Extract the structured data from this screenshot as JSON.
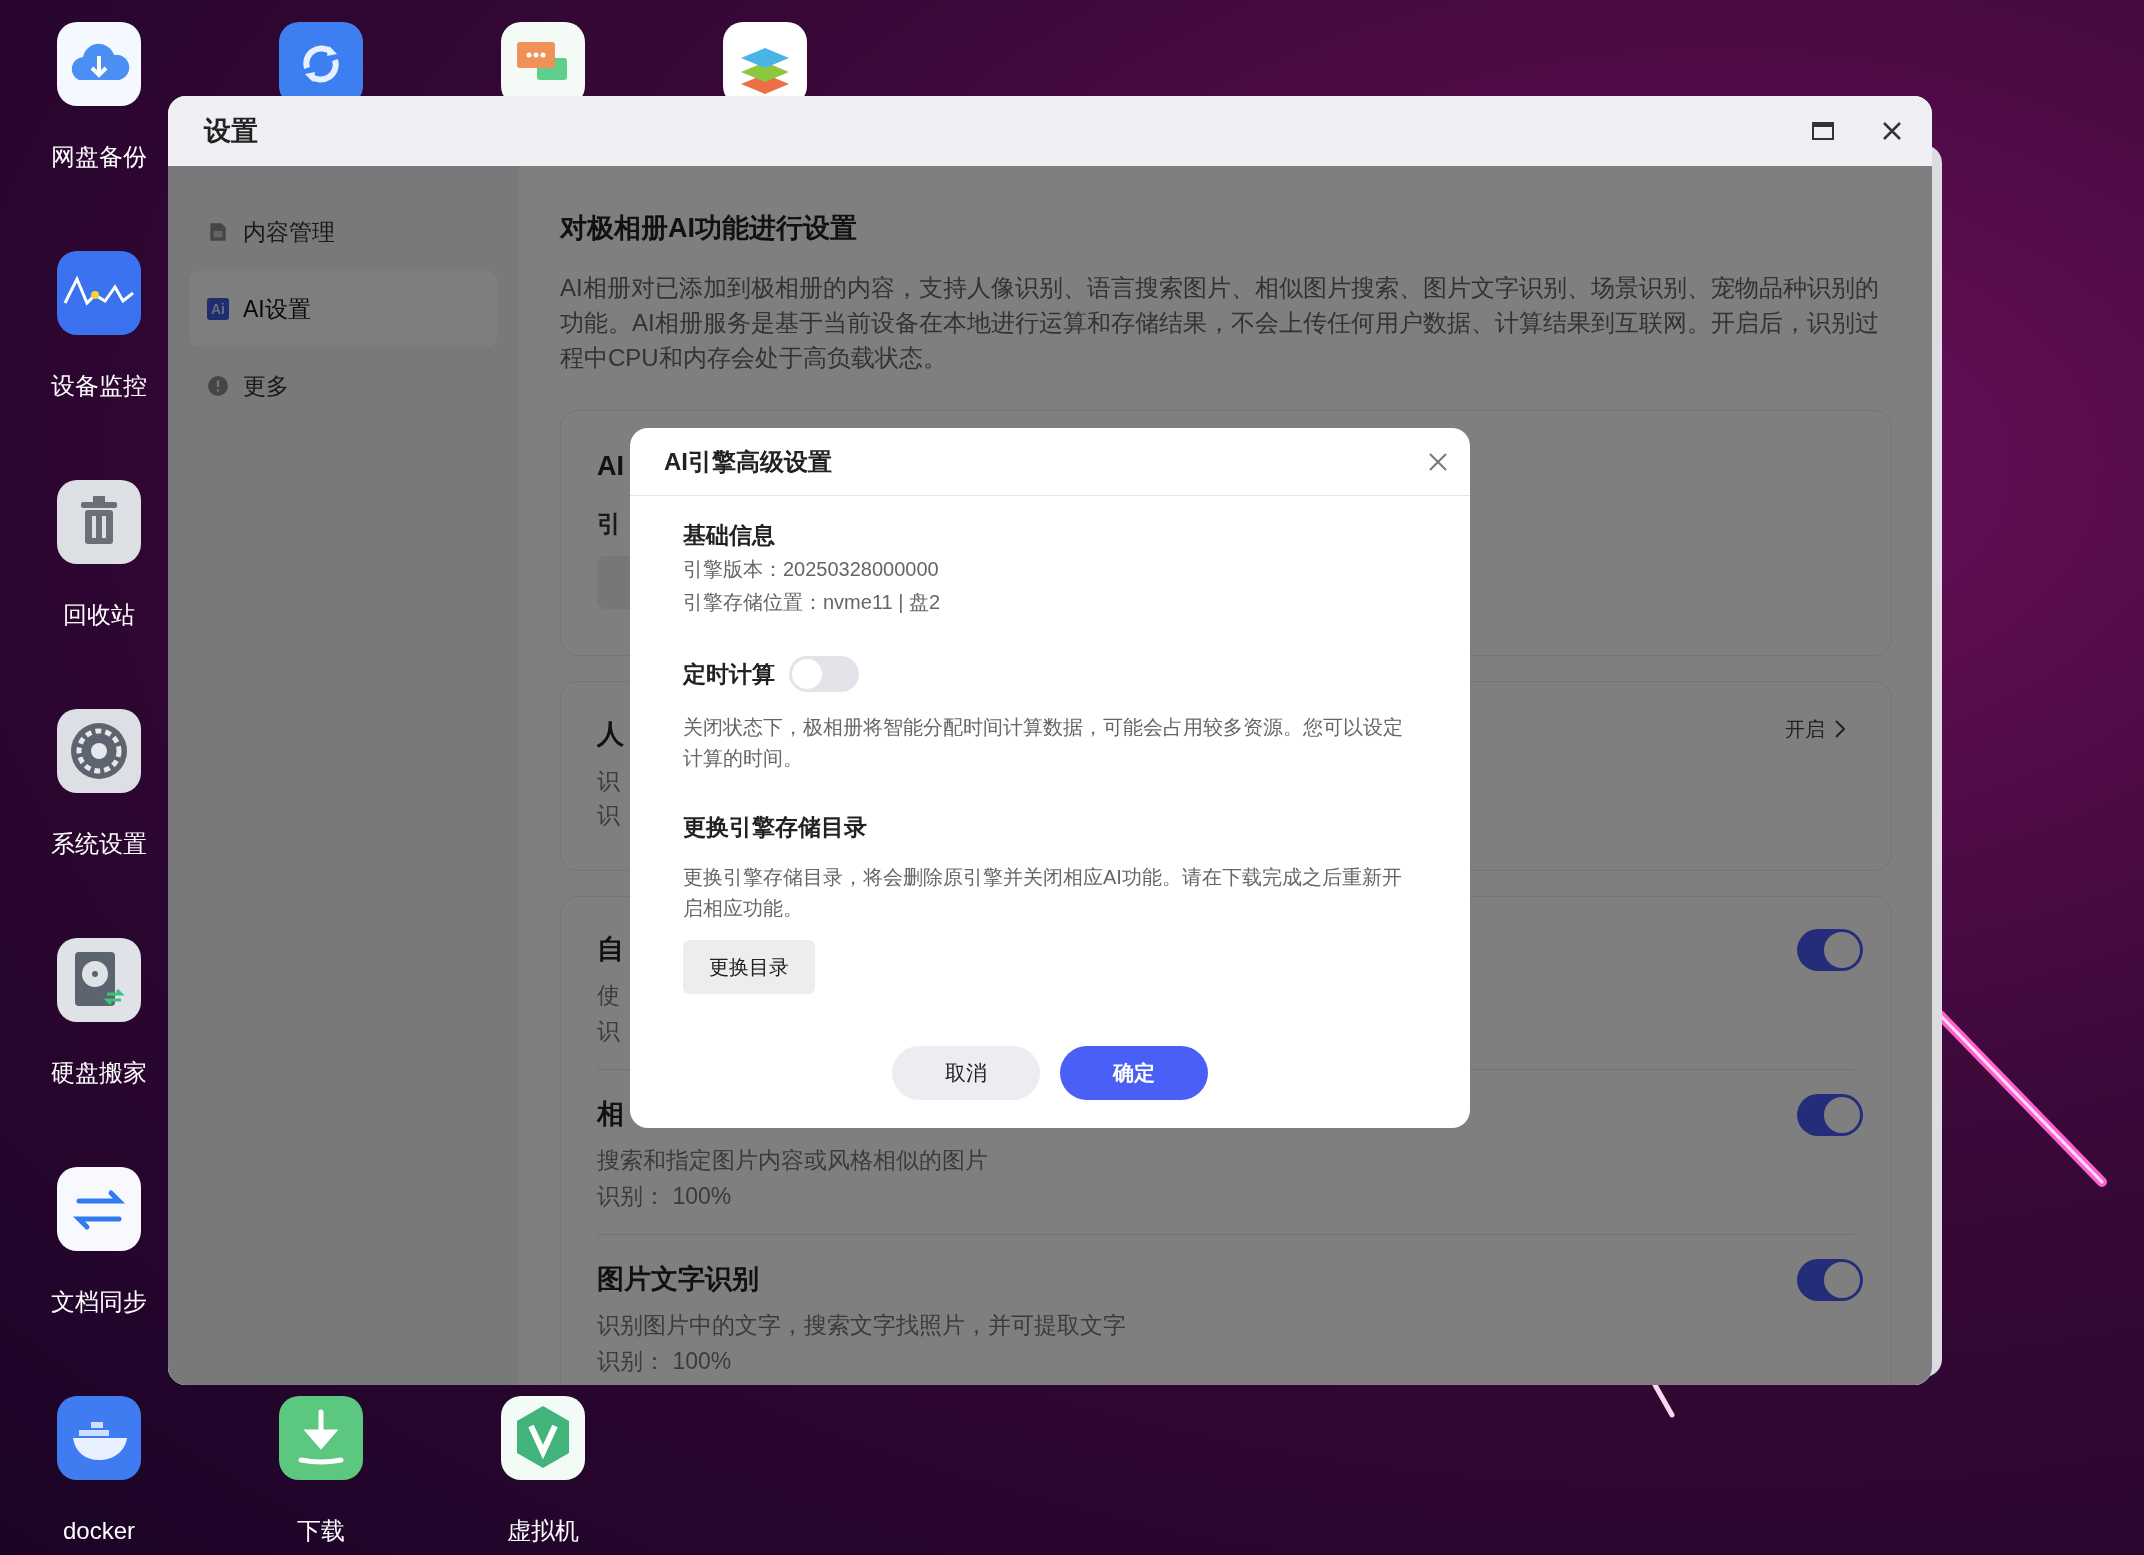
{
  "desktop": {
    "top_row": [
      {
        "kind": "cloud",
        "label": "网盘备份"
      },
      {
        "kind": "sync"
      },
      {
        "kind": "chat"
      },
      {
        "kind": "layers"
      }
    ],
    "left_column": [
      {
        "kind": "monitor",
        "label": "设备监控"
      },
      {
        "kind": "trash",
        "label": "回收站"
      },
      {
        "kind": "gear",
        "label": "系统设置"
      },
      {
        "kind": "disk",
        "label": "硬盘搬家"
      },
      {
        "kind": "transfer",
        "label": "文档同步"
      }
    ],
    "bottom_row": [
      {
        "kind": "docker",
        "label": "docker"
      },
      {
        "kind": "download",
        "label": "下载"
      },
      {
        "kind": "vm",
        "label": "虚拟机"
      }
    ]
  },
  "window": {
    "title": "设置",
    "sidebar": [
      {
        "kind": "doc",
        "label": "内容管理",
        "selected": false
      },
      {
        "kind": "ai",
        "icon_text": "Ai",
        "label": "AI设置",
        "selected": true
      },
      {
        "kind": "info",
        "label": "更多",
        "selected": false
      }
    ],
    "content": {
      "title": "对极相册AI功能进行设置",
      "description": "AI相册对已添加到极相册的内容，支持人像识别、语言搜索图片、相似图片搜索、图片文字识别、场景识别、宠物品种识别的功能。AI相册服务是基于当前设备在本地进行运算和存储结果，不会上传任何用户数据、计算结果到互联网。开启后，识别过程中CPU和内存会处于高负载状态。",
      "cards": [
        {
          "kind": "engine",
          "title": "AI",
          "subtitle": "引"
        },
        {
          "kind": "link",
          "title": "人",
          "lines": [
            "识",
            "识"
          ],
          "action": "开启"
        },
        {
          "kind": "toggles",
          "rows": [
            {
              "title": "自",
              "lines": [
                "使",
                "识"
              ],
              "on": true
            },
            {
              "title": "相",
              "lines": [
                "搜索和指定图片内容或风格相似的图片",
                "识别： 100%"
              ],
              "on": true
            },
            {
              "title": "图片文字识别",
              "lines": [
                "识别图片中的文字，搜索文字找照片，并可提取文字",
                "识别： 100%"
              ],
              "on": true
            }
          ]
        }
      ]
    }
  },
  "dialog": {
    "title": "AI引擎高级设置",
    "sections": [
      {
        "kind": "info",
        "heading": "基础信息",
        "lines": [
          "引擎版本：20250328000000",
          "引擎存储位置：nvme11 | 盘2"
        ]
      },
      {
        "kind": "toggle",
        "heading": "定时计算",
        "on": false,
        "description": "关闭状态下，极相册将智能分配时间计算数据，可能会占用较多资源。您可以设定计算的时间。"
      },
      {
        "kind": "action",
        "heading": "更换引擎存储目录",
        "description": "更换引擎存储目录，将会删除原引擎并关闭相应AI功能。请在下载完成之后重新开启相应功能。",
        "button": "更换目录"
      }
    ],
    "buttons": [
      {
        "kind": "secondary",
        "label": "取消"
      },
      {
        "kind": "primary",
        "label": "确定"
      }
    ]
  }
}
